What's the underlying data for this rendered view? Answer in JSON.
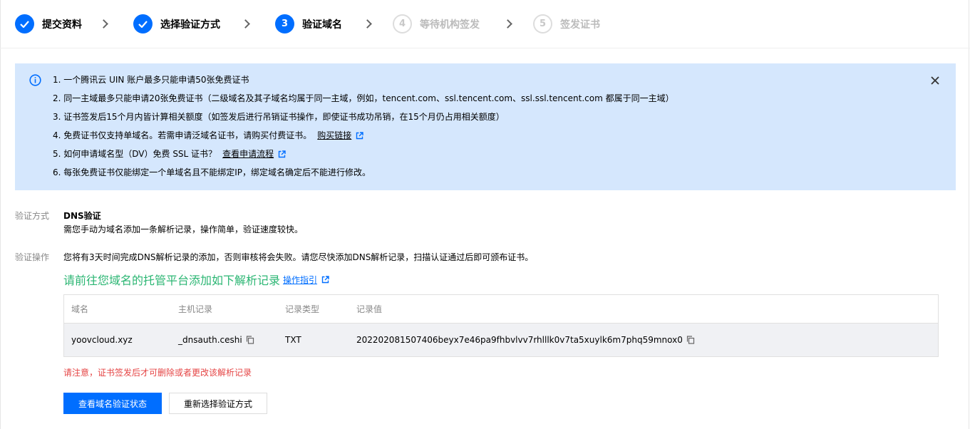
{
  "steps": [
    {
      "label": "提交资料",
      "state": "done"
    },
    {
      "label": "选择验证方式",
      "state": "done"
    },
    {
      "number": "3",
      "label": "验证域名",
      "state": "current"
    },
    {
      "number": "4",
      "label": "等待机构签发",
      "state": "pending"
    },
    {
      "number": "5",
      "label": "签发证书",
      "state": "pending"
    }
  ],
  "notice": {
    "items": [
      "1. 一个腾讯云 UIN 账户最多只能申请50张免费证书",
      "2. 同一主域最多只能申请20张免费证书（二级域名及其子域名均属于同一主域，例如，tencent.com、ssl.tencent.com、ssl.ssl.tencent.com 都属于同一主域）",
      "3. 证书签发后15个月内皆计算相关额度（如签发后进行吊销证书操作，即使证书成功吊销，在15个月仍占用相关额度）",
      "4. 免费证书仅支持单域名。若需申请泛域名证书，请购买付费证书。",
      "5. 如何申请域名型（DV）免费 SSL 证书？",
      "6. 每张免费证书仅能绑定一个单域名且不能绑定IP，绑定域名确定后不能进行修改。"
    ],
    "buy_link": "购买链接",
    "process_link": "查看申请流程"
  },
  "verify": {
    "method_label": "验证方式",
    "method_title": "DNS验证",
    "method_desc": "需您手动为域名添加一条解析记录，操作简单，验证速度较快。",
    "op_label": "验证操作",
    "op_desc": "您将有3天时间完成DNS解析记录的添加，否则审核将会失败。请您尽快添加DNS解析记录，扫描认证通过后即可颁布证书。",
    "guide_title": "请前往您域名的托管平台添加如下解析记录",
    "guide_link": "操作指引"
  },
  "table": {
    "headers": [
      "域名",
      "主机记录",
      "记录类型",
      "记录值"
    ],
    "row": {
      "domain": "yoovcloud.xyz",
      "host": "_dnsauth.ceshi",
      "type": "TXT",
      "value": "202202081507406beyx7e46pa9fhbvlvv7rhlllk0v7ta5xuylk6m7phq59mnox0"
    }
  },
  "warning": "请注意，证书签发后才可删除或者更改该解析记录",
  "buttons": {
    "check_status": "查看域名验证状态",
    "reselect": "重新选择验证方式"
  },
  "colors": {
    "primary": "#006eff",
    "notice_bg": "#d5e7fd",
    "guide_green": "#2bb673",
    "warning_red": "#e54545"
  }
}
